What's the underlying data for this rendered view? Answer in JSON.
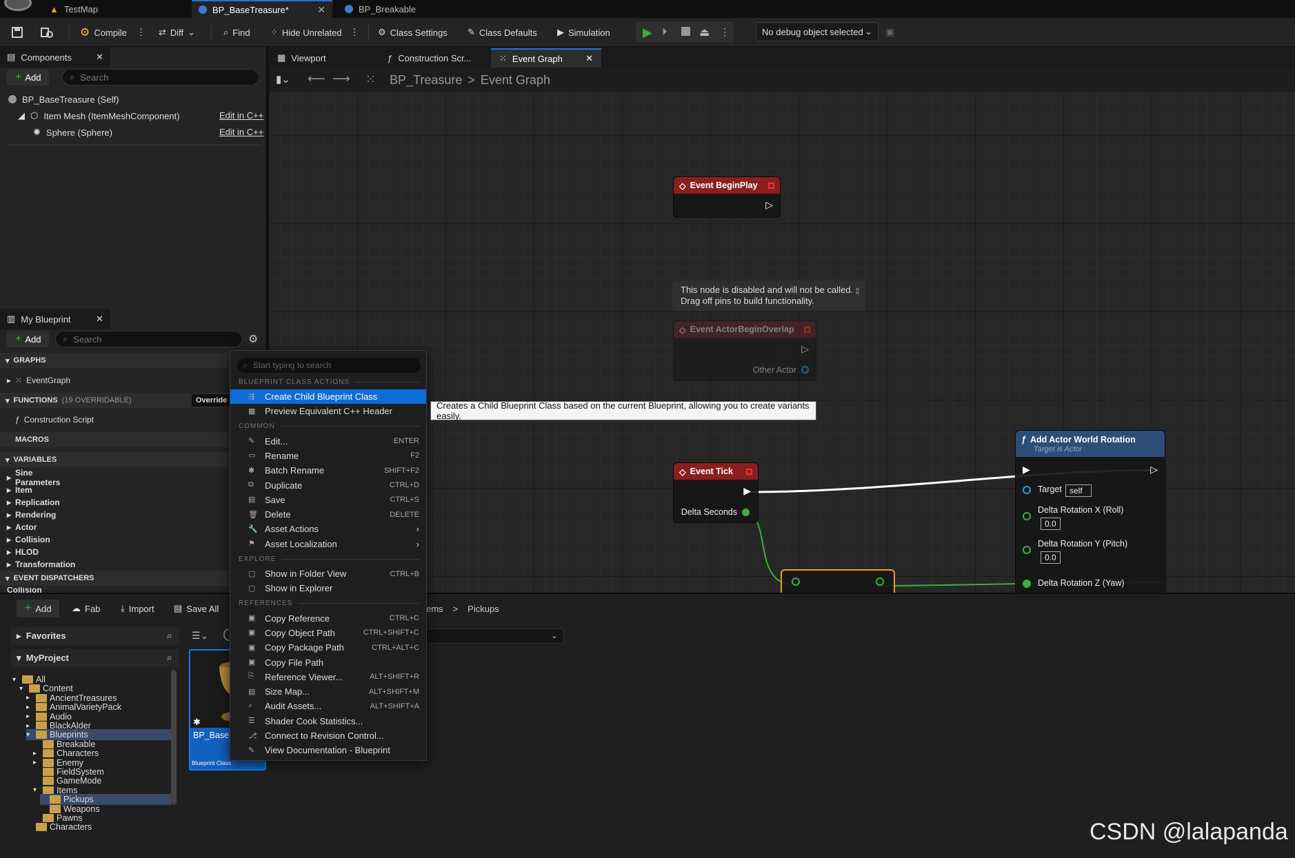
{
  "tabs": {
    "testmap": "TestMap",
    "base_treasure": "BP_BaseTreasure*",
    "breakable": "BP_Breakable"
  },
  "toolbar": {
    "compile": "Compile",
    "diff": "Diff",
    "find": "Find",
    "hide_unrelated": "Hide Unrelated",
    "class_settings": "Class Settings",
    "class_defaults": "Class Defaults",
    "simulation": "Simulation",
    "debug_object": "No debug object selected"
  },
  "components": {
    "tab": "Components",
    "add": "Add",
    "search_placeholder": "Search",
    "self": "BP_BaseTreasure (Self)",
    "item_mesh": "Item Mesh (ItemMeshComponent)",
    "sphere": "Sphere (Sphere)",
    "edit_cpp": "Edit in C++"
  },
  "my_blueprint": {
    "tab": "My Blueprint",
    "add": "Add",
    "search_placeholder": "Search",
    "graphs": "GRAPHS",
    "event_graph": "EventGraph",
    "functions": "FUNCTIONS",
    "functions_count": "(19 OVERRIDABLE)",
    "override": "Override",
    "construction_script": "Construction Script",
    "macros": "MACROS",
    "variables": "VARIABLES",
    "variable_groups": [
      "Sine Parameters",
      "Item",
      "Replication",
      "Rendering",
      "Actor",
      "Collision",
      "HLOD",
      "Transformation"
    ],
    "event_dispatchers": "EVENT DISPATCHERS",
    "collision_partial": "Collision"
  },
  "graph": {
    "tabs": {
      "viewport": "Viewport",
      "construction": "Construction Scr...",
      "event_graph": "Event Graph"
    },
    "breadcrumb_bp": "BP_Treasure",
    "breadcrumb_sep": ">",
    "breadcrumb_graph": "Event Graph",
    "nodes": {
      "begin_play": "Event BeginPlay",
      "disabled_comment_1": "This node is disabled and will not be called.",
      "disabled_comment_2": "Drag off pins to build functionality.",
      "begin_overlap": "Event ActorBeginOverlap",
      "other_actor": "Other Actor",
      "event_tick": "Event Tick",
      "delta_seconds": "Delta Seconds",
      "add_rotation_title": "Add Actor World Rotation",
      "add_rotation_sub": "Target is Actor",
      "target": "Target",
      "self": "self",
      "rot_x": "Delta Rotation X (Roll)",
      "rot_y": "Delta Rotation Y (Pitch)",
      "rot_z": "Delta Rotation Z (Yaw)",
      "zero": "0.0"
    }
  },
  "context_menu": {
    "search_placeholder": "Start typing to search",
    "sections": {
      "blueprint_class_actions": "BLUEPRINT CLASS ACTIONS",
      "common": "COMMON",
      "explore": "EXPLORE",
      "references": "REFERENCES"
    },
    "bp_items": [
      {
        "label": "Create Child Blueprint Class",
        "shortcut": ""
      },
      {
        "label": "Preview Equivalent C++ Header",
        "shortcut": ""
      }
    ],
    "common_items": [
      {
        "label": "Edit...",
        "shortcut": "ENTER"
      },
      {
        "label": "Rename",
        "shortcut": "F2"
      },
      {
        "label": "Batch Rename",
        "shortcut": "SHIFT+F2"
      },
      {
        "label": "Duplicate",
        "shortcut": "CTRL+D"
      },
      {
        "label": "Save",
        "shortcut": "CTRL+S"
      },
      {
        "label": "Delete",
        "shortcut": "DELETE"
      },
      {
        "label": "Asset Actions",
        "shortcut": ""
      },
      {
        "label": "Asset Localization",
        "shortcut": ""
      }
    ],
    "explore_items": [
      {
        "label": "Show in Folder View",
        "shortcut": "CTRL+B"
      },
      {
        "label": "Show in Explorer",
        "shortcut": ""
      }
    ],
    "reference_items": [
      {
        "label": "Copy Reference",
        "shortcut": "CTRL+C"
      },
      {
        "label": "Copy Object Path",
        "shortcut": "CTRL+SHIFT+C"
      },
      {
        "label": "Copy Package Path",
        "shortcut": "CTRL+ALT+C"
      },
      {
        "label": "Copy File Path",
        "shortcut": ""
      },
      {
        "label": "Reference Viewer...",
        "shortcut": "ALT+SHIFT+R"
      },
      {
        "label": "Size Map...",
        "shortcut": "ALT+SHIFT+M"
      },
      {
        "label": "Audit Assets...",
        "shortcut": "ALT+SHIFT+A"
      },
      {
        "label": "Shader Cook Statistics...",
        "shortcut": ""
      },
      {
        "label": "Connect to Revision Control...",
        "shortcut": ""
      },
      {
        "label": "View Documentation - Blueprint",
        "shortcut": ""
      }
    ],
    "tooltip": "Creates a Child Blueprint Class based on the current Blueprint, allowing you to create variants easily."
  },
  "content_browser": {
    "add": "Add",
    "fab": "Fab",
    "import": "Import",
    "save_all": "Save All",
    "path_items": "ems",
    "path_sep": ">",
    "path_pickups": "Pickups",
    "favorites": "Favorites",
    "project": "MyProject",
    "tree": [
      "All",
      "Content",
      "AncientTreasures",
      "AnimalVarietyPack",
      "Audio",
      "BlackAlder",
      "Blueprints",
      "Breakable",
      "Characters",
      "Enemy",
      "FieldSystem",
      "GameMode",
      "Items",
      "Pickups",
      "Weapons",
      "Pawns",
      "Characters"
    ],
    "asset_name": "BP_BaseT",
    "asset_type": "Blueprint Class"
  },
  "watermark": "CSDN @lalapanda"
}
